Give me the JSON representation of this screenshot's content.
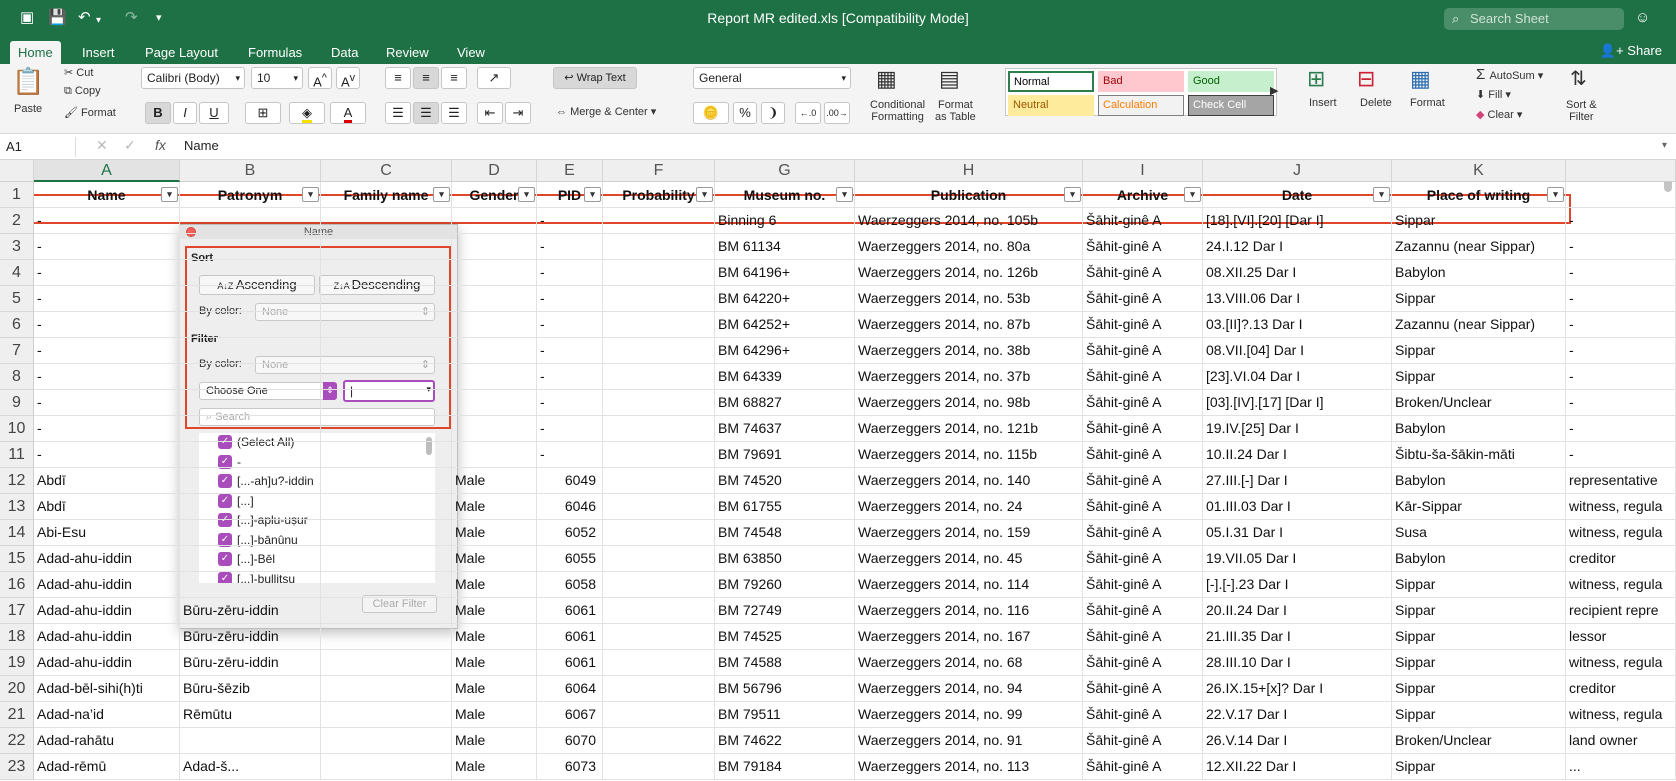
{
  "window": {
    "title": "Report MR edited.xls  [Compatibility Mode]",
    "search_placeholder": "Search Sheet"
  },
  "tabs": [
    "Home",
    "Insert",
    "Page Layout",
    "Formulas",
    "Data",
    "Review",
    "View"
  ],
  "share_label": "Share",
  "ribbon": {
    "paste": "Paste",
    "cut": "Cut",
    "copy": "Copy",
    "format": "Format",
    "font_name": "Calibri (Body)",
    "font_size": "10",
    "bold": "B",
    "italic": "I",
    "underline": "U",
    "wrap_text": "Wrap Text",
    "merge_center": "Merge & Center",
    "number_format": "General",
    "conditional_formatting": [
      "Conditional",
      "Formatting"
    ],
    "format_as_table": [
      "Format",
      "as Table"
    ],
    "styles": [
      {
        "label": "Normal",
        "bg": "#ffffff",
        "color": "#000000",
        "border": "#2e7d4f"
      },
      {
        "label": "Bad",
        "bg": "#ffc7ce",
        "color": "#9c0006",
        "border": "#ffc7ce"
      },
      {
        "label": "Good",
        "bg": "#c6efce",
        "color": "#006100",
        "border": "#c6efce"
      },
      {
        "label": "Neutral",
        "bg": "#ffeb9c",
        "color": "#9c5700",
        "border": "#ffeb9c"
      },
      {
        "label": "Calculation",
        "bg": "#f2f2f2",
        "color": "#fa7d00",
        "border": "#7f7f7f"
      },
      {
        "label": "Check Cell",
        "bg": "#a5a5a5",
        "color": "#ffffff",
        "border": "#3f3f3f"
      }
    ],
    "insert": "Insert",
    "delete": "Delete",
    "format_cells": "Format",
    "autosum": "AutoSum",
    "fill": "Fill",
    "clear": "Clear",
    "sort_filter": [
      "Sort &",
      "Filter"
    ]
  },
  "formula_bar": {
    "cell_ref": "A1",
    "fx": "fx",
    "value": "Name"
  },
  "columns": [
    "A",
    "B",
    "C",
    "D",
    "E",
    "F",
    "G",
    "H",
    "I",
    "J",
    "K"
  ],
  "header_row": [
    "Name",
    "Patronym",
    "Family name",
    "Gender",
    "PID",
    "Probability",
    "Museum no.",
    "Publication",
    "Archive",
    "Date",
    "Place of writing"
  ],
  "rows": [
    {
      "n": "2",
      "cells": [
        "-",
        "",
        "",
        "",
        "-",
        "",
        "Binning 6",
        "Waerzeggers 2014, no. 105b",
        "Šāhit-ginê A",
        "[18].[VI].[20] [Dar I]",
        "Sippar",
        "-"
      ]
    },
    {
      "n": "3",
      "cells": [
        "-",
        "",
        "",
        "",
        "-",
        "",
        "BM 61134",
        "Waerzeggers 2014, no. 80a",
        "Šāhit-ginê A",
        "24.I.12 Dar I",
        "Zazannu (near Sippar)",
        "-"
      ]
    },
    {
      "n": "4",
      "cells": [
        "-",
        "",
        "",
        "",
        "-",
        "",
        "BM 64196+",
        "Waerzeggers 2014, no. 126b",
        "Šāhit-ginê A",
        "08.XII.25 Dar I",
        "Babylon",
        "-"
      ]
    },
    {
      "n": "5",
      "cells": [
        "-",
        "",
        "",
        "",
        "-",
        "",
        "BM 64220+",
        "Waerzeggers 2014, no. 53b",
        "Šāhit-ginê A",
        "13.VIII.06 Dar I",
        "Sippar",
        "-"
      ]
    },
    {
      "n": "6",
      "cells": [
        "-",
        "",
        "",
        "",
        "-",
        "",
        "BM 64252+",
        "Waerzeggers 2014, no. 87b",
        "Šāhit-ginê A",
        "03.[II]?.13 Dar I",
        "Zazannu (near Sippar)",
        "-"
      ]
    },
    {
      "n": "7",
      "cells": [
        "-",
        "",
        "",
        "",
        "-",
        "",
        "BM 64296+",
        "Waerzeggers 2014, no. 38b",
        "Šāhit-ginê A",
        "08.VII.[04] Dar I",
        "Sippar",
        "-"
      ]
    },
    {
      "n": "8",
      "cells": [
        "-",
        "",
        "",
        "",
        "-",
        "",
        "BM 64339",
        "Waerzeggers 2014, no. 37b",
        "Šāhit-ginê A",
        "[23].VI.04 Dar I",
        "Sippar",
        "-"
      ]
    },
    {
      "n": "9",
      "cells": [
        "-",
        "",
        "",
        "",
        "-",
        "",
        "BM 68827",
        "Waerzeggers 2014, no. 98b",
        "Šāhit-ginê A",
        "[03].[IV].[17] [Dar I]",
        "Broken/Unclear",
        "-"
      ]
    },
    {
      "n": "10",
      "cells": [
        "-",
        "",
        "",
        "",
        "-",
        "",
        "BM 74637",
        "Waerzeggers 2014, no. 121b",
        "Šāhit-ginê A",
        "19.IV.[25] Dar I",
        "Babylon",
        "-"
      ]
    },
    {
      "n": "11",
      "cells": [
        "-",
        "",
        "",
        "",
        "-",
        "",
        "BM 79691",
        "Waerzeggers 2014, no. 115b",
        "Šāhit-ginê A",
        "10.II.24 Dar I",
        "Šibtu-ša-šākin-māti",
        "-"
      ]
    },
    {
      "n": "12",
      "cells": [
        "Abdī",
        "",
        "",
        "Male",
        "6049",
        "",
        "BM 74520",
        "Waerzeggers 2014, no. 140",
        "Šāhit-ginê A",
        "27.III.[-] Dar I",
        "Babylon",
        "representative"
      ]
    },
    {
      "n": "13",
      "cells": [
        "Abdī",
        "",
        "",
        "Male",
        "6046",
        "",
        "BM 61755",
        "Waerzeggers 2014, no. 24",
        "Šāhit-ginê A",
        "01.III.03 Dar I",
        "Kār-Sippar",
        "witness, regula"
      ]
    },
    {
      "n": "14",
      "cells": [
        "Abi-Esu",
        "",
        "",
        "Male",
        "6052",
        "",
        "BM 74548",
        "Waerzeggers 2014, no. 159",
        "Šāhit-ginê A",
        "05.I.31 Dar I",
        "Susa",
        "witness, regula"
      ]
    },
    {
      "n": "15",
      "cells": [
        "Adad-ahu-iddin",
        "",
        "",
        "Male",
        "6055",
        "",
        "BM 63850",
        "Waerzeggers 2014, no. 45",
        "Šāhit-ginê A",
        "19.VII.05 Dar I",
        "Babylon",
        "creditor"
      ]
    },
    {
      "n": "16",
      "cells": [
        "Adad-ahu-iddin",
        "",
        "",
        "Male",
        "6058",
        "",
        "BM 79260",
        "Waerzeggers 2014, no. 114",
        "Šāhit-ginê A",
        "[-].[-].23 Dar I",
        "Sippar",
        "witness, regula"
      ]
    },
    {
      "n": "17",
      "cells": [
        "Adad-ahu-iddin",
        "Būru-zēru-iddin",
        "",
        "Male",
        "6061",
        "",
        "BM 72749",
        "Waerzeggers 2014, no. 116",
        "Šāhit-ginê A",
        "20.II.24 Dar I",
        "Sippar",
        "recipient repre"
      ]
    },
    {
      "n": "18",
      "cells": [
        "Adad-ahu-iddin",
        "Būru-zēru-iddin",
        "",
        "Male",
        "6061",
        "",
        "BM 74525",
        "Waerzeggers 2014, no. 167",
        "Šāhit-ginê A",
        "21.III.35 Dar I",
        "Sippar",
        "lessor"
      ]
    },
    {
      "n": "19",
      "cells": [
        "Adad-ahu-iddin",
        "Būru-zēru-iddin",
        "",
        "Male",
        "6061",
        "",
        "BM 74588",
        "Waerzeggers 2014, no. 68",
        "Šāhit-ginê A",
        "28.III.10 Dar I",
        "Sippar",
        "witness, regula"
      ]
    },
    {
      "n": "20",
      "cells": [
        "Adad-bēl-sihi(h)ti",
        "Būru-šēzib",
        "",
        "Male",
        "6064",
        "",
        "BM 56796",
        "Waerzeggers 2014, no. 94",
        "Šāhit-ginê A",
        "26.IX.15+[x]? Dar I",
        "Sippar",
        "creditor"
      ]
    },
    {
      "n": "21",
      "cells": [
        "Adad-na’id",
        "Rēmūtu",
        "",
        "Male",
        "6067",
        "",
        "BM 79511",
        "Waerzeggers 2014, no. 99",
        "Šāhit-ginê A",
        "22.V.17 Dar I",
        "Sippar",
        "witness, regula"
      ]
    },
    {
      "n": "22",
      "cells": [
        "Adad-rahātu",
        "",
        "",
        "Male",
        "6070",
        "",
        "BM 74622",
        "Waerzeggers 2014, no. 91",
        "Šāhit-ginê A",
        "26.V.14 Dar I",
        "Broken/Unclear",
        "land owner"
      ]
    },
    {
      "n": "23",
      "cells": [
        "Adad-rēmū",
        "Adad-š...",
        "",
        "Male",
        "6073",
        "",
        "BM 79184",
        "Waerzeggers 2014, no. 113",
        "Šāhit-ginê A",
        "12.XII.22 Dar I",
        "Sippar",
        "..."
      ]
    }
  ],
  "filter_popup": {
    "title": "Name",
    "sort_label": "Sort",
    "ascending": "Ascending",
    "descending": "Descending",
    "by_color_label": "By color:",
    "sort_color_value": "None",
    "filter_label": "Filter",
    "filter_color_value": "None",
    "choose_one": "Choose One",
    "search_placeholder": "Search",
    "items": [
      "(Select All)",
      "-",
      "[...-ah]u?-iddin",
      "[...]",
      "[...]-aplu-uṣur",
      "[...]-bānûnu",
      "[...]-Bēl",
      "[...]-bulliṭsu"
    ],
    "clear_filter": "Clear Filter"
  }
}
